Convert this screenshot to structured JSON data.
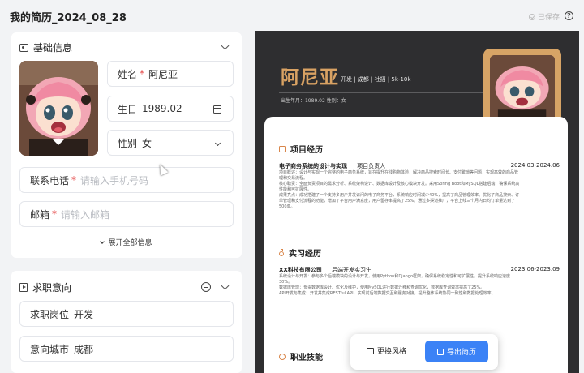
{
  "header": {
    "doc_title": "我的简历_2024_08_28",
    "save_status": "已保存",
    "help_symbol": "?"
  },
  "basic_info": {
    "section_title": "基础信息",
    "fields": {
      "name": {
        "label": "姓名",
        "required": "*",
        "value": "阿尼亚"
      },
      "birthday": {
        "label": "生日",
        "value": "1989.02"
      },
      "gender": {
        "label": "性别",
        "value": "女"
      },
      "phone": {
        "label": "联系电话",
        "required": "*",
        "placeholder": "请输入手机号码"
      },
      "email": {
        "label": "邮箱",
        "required": "*",
        "placeholder": "请输入邮箱"
      }
    },
    "expand_label": "展开全部信息"
  },
  "job_intent": {
    "section_title": "求职意向",
    "fields": {
      "position": {
        "label": "求职岗位",
        "value": "开发"
      },
      "city": {
        "label": "意向城市",
        "value": "成都"
      }
    }
  },
  "preview": {
    "name": "阿尼亚",
    "tags": "开发 | 成都 | 社招 | 5k-10k",
    "meta": "出生年月：1989.02    性别：女",
    "accent_color": "#d9a263",
    "sections": {
      "project": {
        "title": "项目经历",
        "org": "电子商务系统的设计与实现",
        "role": "项目负责人",
        "date": "2024.03-2024.06",
        "lines": [
          "项目概述：设计与实现一个完整的电子商务系统，旨在提升在线购物体验，解决商品搜索时间长、支付繁琐等问题，实现高效的商品管",
          "理和交易流程。",
          "核心职责：全面负责项目的需求分析、系统架构设计、数据库设计及核心模块开发。采用Spring Boot和MySQL搭建后端，确保系统高",
          "性能和可扩展性。",
          "成果亮点：成功搭建了一个支持多用户并发访问的电子商务平台，系统响应时间减少40%，提高了商品管理效率。优化了商品搜索、订",
          "单管理和支付流程的功能，增加了平台用户满意度，用户留存率提高了25%。通过多渠道推广，平台上线三个月内日均订单量达到了",
          "500单。"
        ]
      },
      "internship": {
        "title": "实习经历",
        "org": "XX科技有限公司",
        "role": "后端开发实习生",
        "date": "2023.06-2023.09",
        "lines": [
          "系统设计与开发：参与多个后端模块的设计与开发，使用Python和Django框架，确保系统稳定性和可扩展性，提升系统响应速度",
          "30%。",
          "数据库管理：负责数据库设计、优化及维护，使用MySQL进行数据迁移和查询优化，数据库查询效率提高了25%。",
          "API开发与集成：开发并集成RESTful API，实现前后端数据交互和服务对接，提升整体系统协同一致性和数据处理效率。"
        ]
      },
      "skills": {
        "title": "职业技能"
      }
    }
  },
  "actions": {
    "change_style": "更换风格",
    "export": "导出简历"
  },
  "colors": {
    "primary": "#3b82f6",
    "preview_bg": "#2e2e30",
    "photo_frame": "#d7a466",
    "required": "#e54b4b"
  }
}
